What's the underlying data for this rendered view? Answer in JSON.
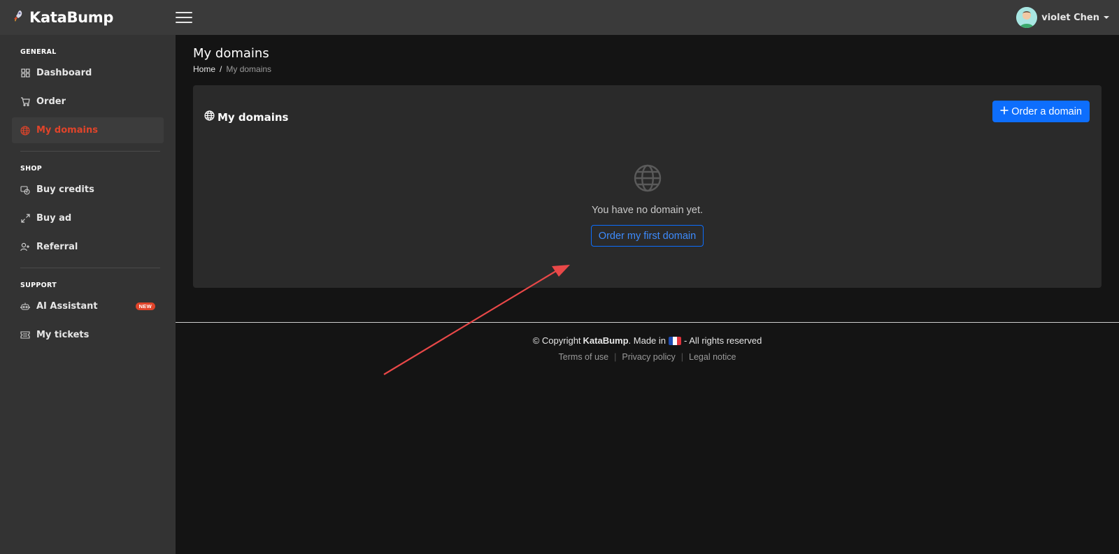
{
  "topbar": {
    "brand": "KataBump",
    "user_name": "violet Chen"
  },
  "sidebar": {
    "sections": [
      {
        "label": "GENERAL",
        "items": [
          {
            "label": "Dashboard",
            "icon": "grid-icon"
          },
          {
            "label": "Order",
            "icon": "cart-icon"
          },
          {
            "label": "My domains",
            "icon": "globe-icon",
            "active": true
          }
        ]
      },
      {
        "label": "SHOP",
        "items": [
          {
            "label": "Buy credits",
            "icon": "credits-icon"
          },
          {
            "label": "Buy ad",
            "icon": "expand-icon"
          },
          {
            "label": "Referral",
            "icon": "user-plus-icon"
          }
        ]
      },
      {
        "label": "SUPPORT",
        "items": [
          {
            "label": "AI Assistant",
            "icon": "robot-icon",
            "badge": "NEW"
          },
          {
            "label": "My tickets",
            "icon": "ticket-icon"
          }
        ]
      }
    ]
  },
  "main": {
    "page_title": "My domains",
    "breadcrumb": {
      "home": "Home",
      "separator": "/",
      "current": "My domains"
    },
    "card": {
      "title": "My domains",
      "order_button": "Order a domain",
      "empty_text": "You have no domain yet.",
      "first_domain_button": "Order my first domain"
    }
  },
  "footer": {
    "copyright_prefix": "© Copyright",
    "brand": "KataBump",
    "made_in": ". Made in",
    "rights": "- All rights reserved",
    "links": [
      "Terms of use",
      "Privacy policy",
      "Legal notice"
    ]
  },
  "colors": {
    "accent_active": "#e0442a",
    "primary_button": "#0d6efd",
    "annotation_arrow": "#e94848"
  }
}
